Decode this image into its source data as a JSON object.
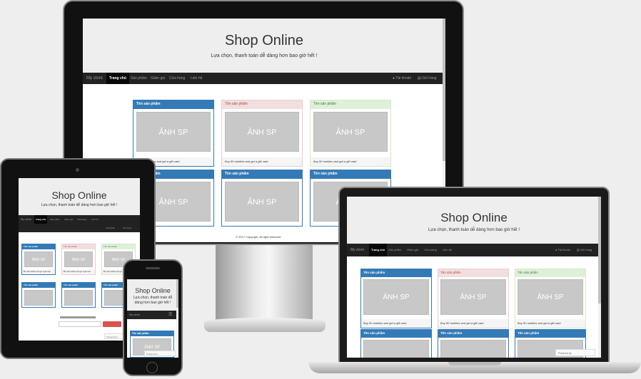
{
  "site": {
    "title": "Shop Online",
    "tagline": "Lựa chọn, thanh toán dễ dàng hơn bao giờ hết !",
    "brand": "My store",
    "nav_items": [
      "Trang chủ",
      "Sản phẩm",
      "Giảm giá",
      "Cửa hàng",
      "Liên hệ"
    ],
    "account": "Tài khoản",
    "cart": "Giỏ hàng",
    "product_heading": "Tên sản phẩm",
    "image_placeholder": "ẢNH SP",
    "product_footer": "Buy 50 mobiles and get a gift card",
    "copyright": "© 2017 Copyright, All right reserved",
    "powered_by": "Powered by",
    "menu_toggle": "☰"
  },
  "colors": {
    "primary": "#337ab7",
    "danger_bg": "#f2dede",
    "success_bg": "#dff0d8",
    "navbar": "#222222",
    "jumbotron": "#eeeeee"
  }
}
